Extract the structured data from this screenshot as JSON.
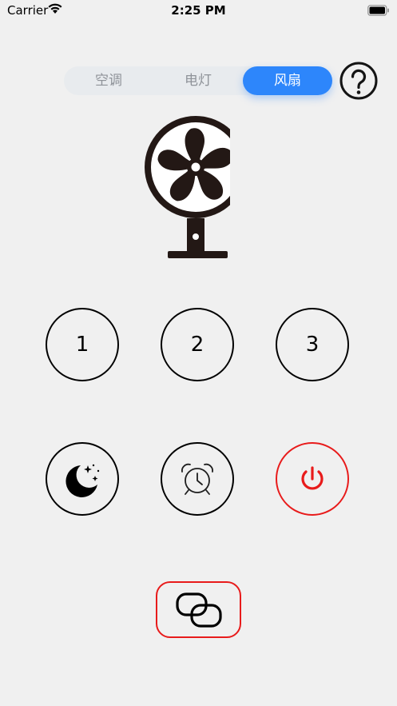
{
  "status_bar": {
    "carrier": "Carrier",
    "time": "2:25 PM"
  },
  "tabs": [
    {
      "label": "空调",
      "active": false
    },
    {
      "label": "电灯",
      "active": false
    },
    {
      "label": "风扇",
      "active": true
    }
  ],
  "speed_buttons": [
    "1",
    "2",
    "3"
  ],
  "function_buttons": [
    {
      "icon": "moon-stars-icon"
    },
    {
      "icon": "alarm-clock-icon"
    },
    {
      "icon": "power-icon"
    }
  ],
  "link_button": {
    "icon": "link-icon"
  },
  "colors": {
    "accent": "#2d86fb",
    "power": "#e81b1b",
    "background": "#f0f0f0"
  }
}
